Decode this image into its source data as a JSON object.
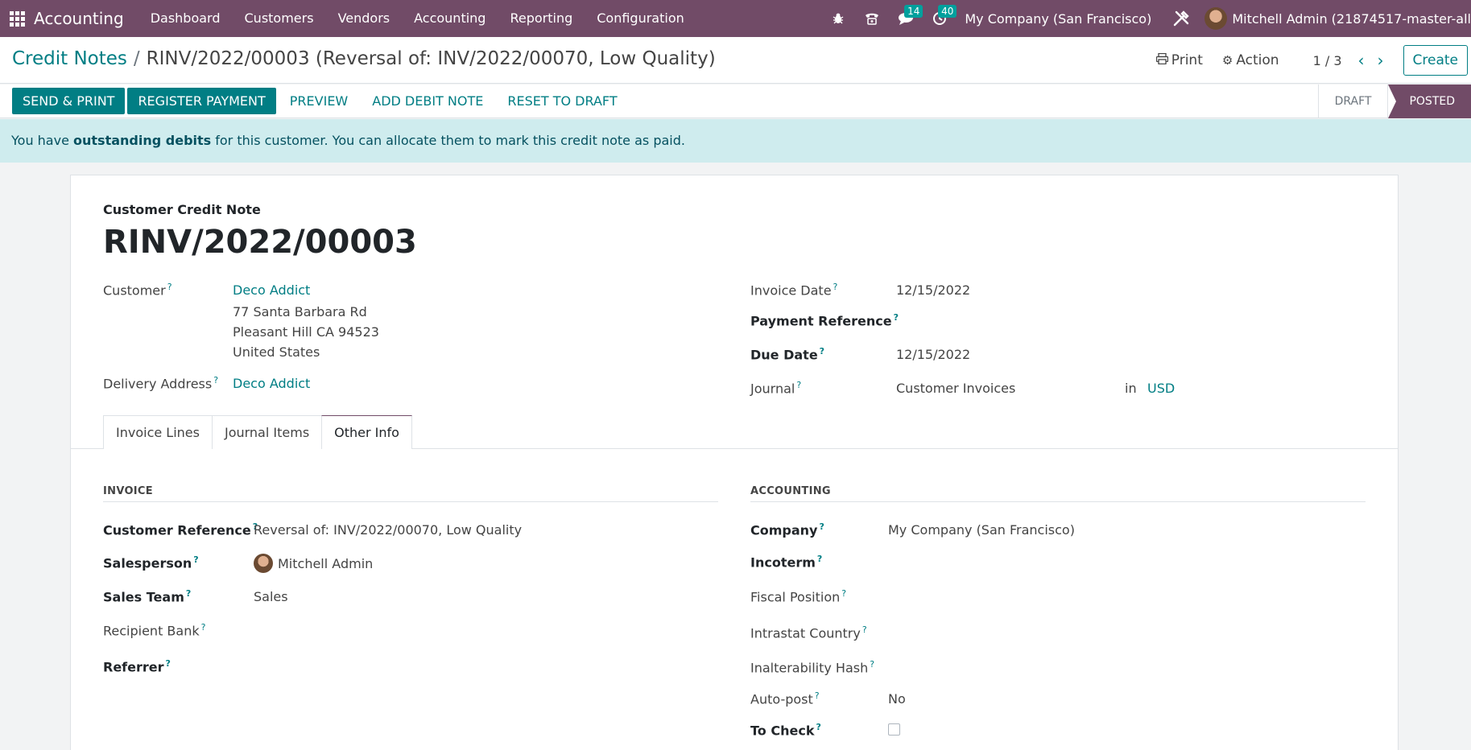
{
  "navbar": {
    "app_name": "Accounting",
    "menu": [
      "Dashboard",
      "Customers",
      "Vendors",
      "Accounting",
      "Reporting",
      "Configuration"
    ],
    "messages_count": "14",
    "activities_count": "40",
    "company": "My Company (San Francisco)",
    "user": "Mitchell Admin (21874517-master-all"
  },
  "control_panel": {
    "breadcrumb_parent": "Credit Notes",
    "breadcrumb_separator": "/",
    "breadcrumb_current": "RINV/2022/00003 (Reversal of: INV/2022/00070, Low Quality)",
    "print_label": "Print",
    "action_label": "Action",
    "pager": "1 / 3",
    "create_label": "Create"
  },
  "statusbar": {
    "send_print": "SEND & PRINT",
    "register_payment": "REGISTER PAYMENT",
    "preview": "PREVIEW",
    "add_debit_note": "ADD DEBIT NOTE",
    "reset_to_draft": "RESET TO DRAFT",
    "stages": [
      "DRAFT",
      "POSTED"
    ],
    "current_stage": "POSTED"
  },
  "alert": {
    "prefix": "You have ",
    "bold": "outstanding debits",
    "suffix": " for this customer. You can allocate them to mark this credit note as paid."
  },
  "form": {
    "doc_type": "Customer Credit Note",
    "name": "RINV/2022/00003",
    "customer_label": "Customer",
    "customer": "Deco Addict",
    "address": [
      "77 Santa Barbara Rd",
      "Pleasant Hill CA 94523",
      "United States"
    ],
    "delivery_label": "Delivery Address",
    "delivery": "Deco Addict",
    "invoice_date_label": "Invoice Date",
    "invoice_date": "12/15/2022",
    "payment_ref_label": "Payment Reference",
    "due_date_label": "Due Date",
    "due_date": "12/15/2022",
    "journal_label": "Journal",
    "journal": "Customer Invoices",
    "journal_in": "in",
    "currency": "USD",
    "help_mark": "?"
  },
  "tabs": [
    "Invoice Lines",
    "Journal Items",
    "Other Info"
  ],
  "active_tab": "Other Info",
  "other_info": {
    "invoice_section": "INVOICE",
    "customer_ref_label": "Customer Reference",
    "customer_ref": "Reversal of: INV/2022/00070, Low Quality",
    "salesperson_label": "Salesperson",
    "salesperson": "Mitchell Admin",
    "sales_team_label": "Sales Team",
    "sales_team": "Sales",
    "recipient_bank_label": "Recipient Bank",
    "referrer_label": "Referrer",
    "accounting_section": "ACCOUNTING",
    "company_label": "Company",
    "company": "My Company (San Francisco)",
    "incoterm_label": "Incoterm",
    "fiscal_position_label": "Fiscal Position",
    "intrastat_label": "Intrastat Country",
    "hash_label": "Inalterability Hash",
    "autopost_label": "Auto-post",
    "autopost": "No",
    "to_check_label": "To Check",
    "to_check": false
  }
}
